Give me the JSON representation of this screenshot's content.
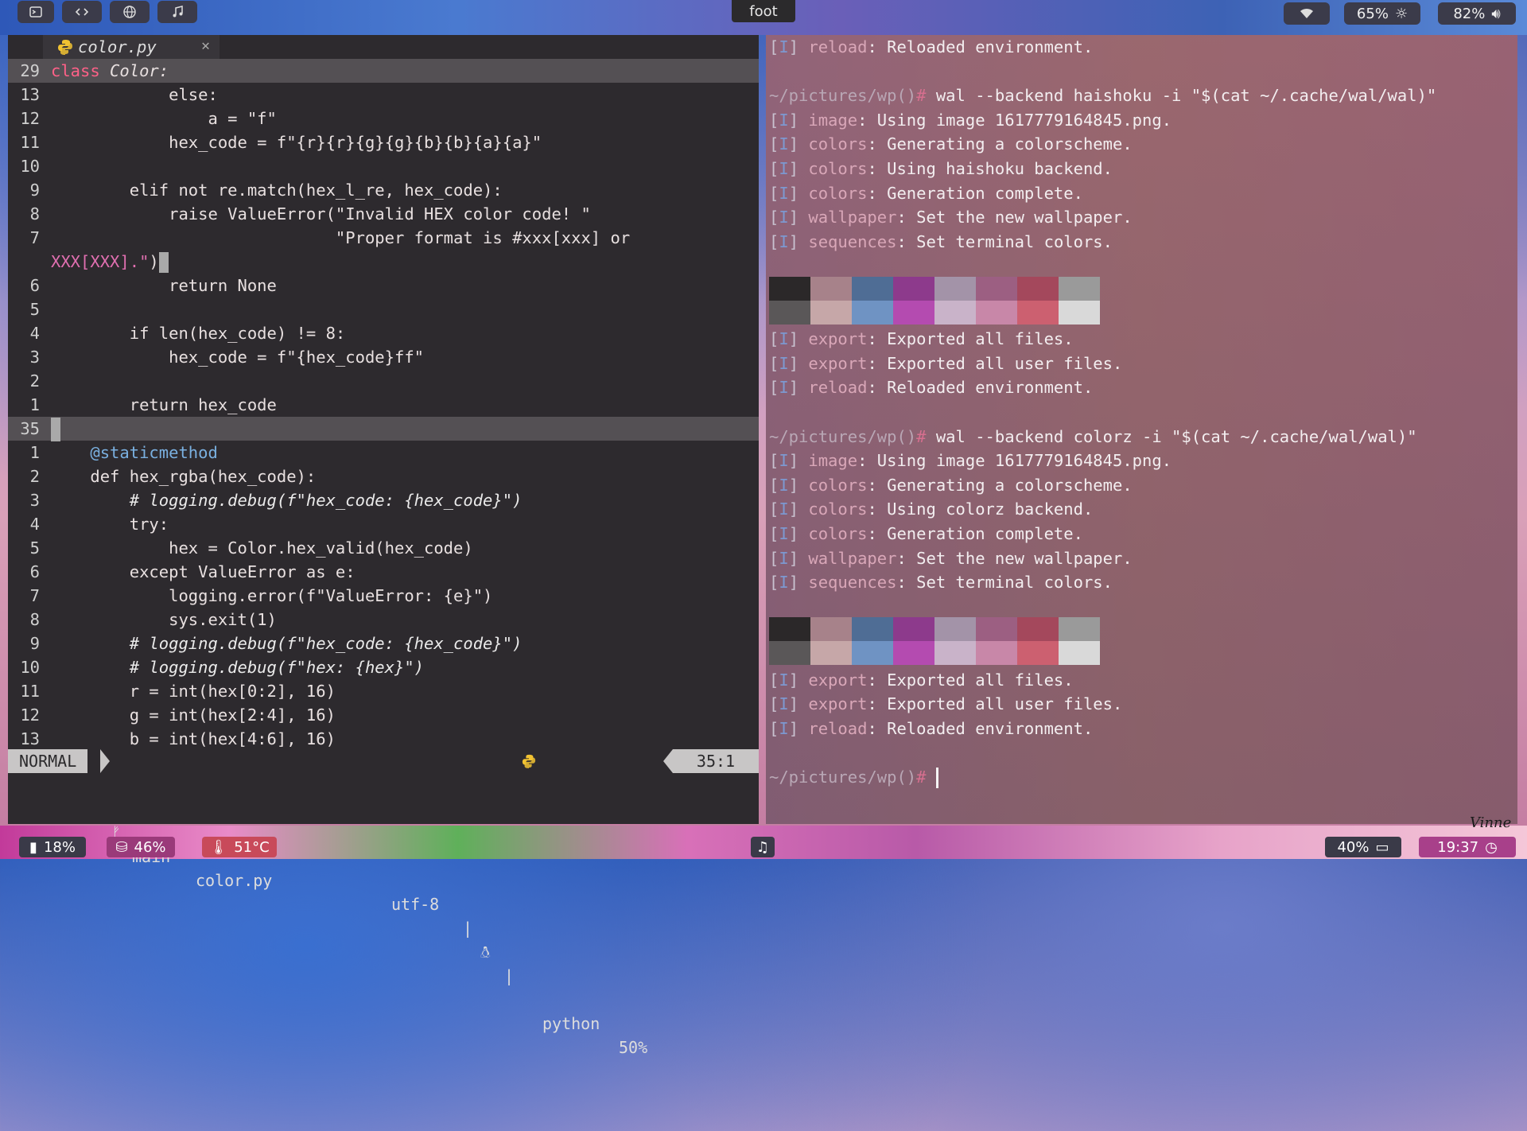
{
  "topbar": {
    "title": "foot",
    "wifi_icon": "wifi-icon",
    "brightness": "65%",
    "volume": "82%",
    "colors": {
      "pill_bg": "#3b3b4a"
    }
  },
  "editor": {
    "tab": {
      "filename": "color.py",
      "close": "✕"
    },
    "lines_upper": [
      {
        "n": "29",
        "kind": "class"
      },
      {
        "n": "13",
        "t": "            else:"
      },
      {
        "n": "12",
        "t": "                a = \"f\""
      },
      {
        "n": "11",
        "t": "            hex_code = f\"{r}{r}{g}{g}{b}{b}{a}{a}\""
      },
      {
        "n": "10",
        "t": ""
      },
      {
        "n": "9",
        "t": "        elif not re.match(hex_l_re, hex_code):"
      },
      {
        "n": "8",
        "t": "            raise ValueError(\"Invalid HEX color code! \""
      },
      {
        "n": "7",
        "t": "                             \"Proper format is #xxx[xxx] or"
      },
      {
        "n": "",
        "t": "XXX[XXX].\")"
      },
      {
        "n": "6",
        "t": "            return None"
      },
      {
        "n": "5",
        "t": ""
      },
      {
        "n": "4",
        "t": "        if len(hex_code) != 8:"
      },
      {
        "n": "3",
        "t": "            hex_code = f\"{hex_code}ff\""
      },
      {
        "n": "2",
        "t": ""
      },
      {
        "n": "1",
        "t": "        return hex_code"
      }
    ],
    "class_line": {
      "kw": "class",
      "name": " Color:"
    },
    "current_line": "35",
    "lines_lower": [
      {
        "n": "1",
        "t": "    @staticmethod"
      },
      {
        "n": "2",
        "t": "    def hex_rgba(hex_code):"
      },
      {
        "n": "3",
        "t": "        # logging.debug(f\"hex_code: {hex_code}\")"
      },
      {
        "n": "4",
        "t": "        try:"
      },
      {
        "n": "5",
        "t": "            hex = Color.hex_valid(hex_code)"
      },
      {
        "n": "6",
        "t": "        except ValueError as e:"
      },
      {
        "n": "7",
        "t": "            logging.error(f\"ValueError: {e}\")"
      },
      {
        "n": "8",
        "t": "            sys.exit(1)"
      },
      {
        "n": "9",
        "t": "        # logging.debug(f\"hex_code: {hex_code}\")"
      },
      {
        "n": "10",
        "t": "        # logging.debug(f\"hex: {hex}\")"
      },
      {
        "n": "11",
        "t": "        r = int(hex[0:2], 16)"
      },
      {
        "n": "12",
        "t": "        g = int(hex[2:4], 16)"
      },
      {
        "n": "13",
        "t": "        b = int(hex[4:6], 16)"
      }
    ],
    "status": {
      "mode": "NORMAL",
      "branch_icon": "git-branch-icon",
      "branch": "main",
      "file": "color.py",
      "encoding": "utf-8",
      "sep": "|",
      "os_icon": "linux-icon",
      "filetype": "python",
      "percent": "50%",
      "position": "35:1"
    }
  },
  "terminal": {
    "lines": [
      {
        "tag": "I",
        "mod": "reload",
        "msg": ": Reloaded environment."
      },
      {
        "blank": true
      },
      {
        "prompt": "~/pictures/wp()",
        "hash": "#",
        "cmd": " wal --backend haishoku -i \"$(cat ~/.cache/wal/wal)\""
      },
      {
        "tag": "I",
        "mod": "image",
        "msg": ": Using image 1617779164845.png."
      },
      {
        "tag": "I",
        "mod": "colors",
        "msg": ": Generating a colorscheme."
      },
      {
        "tag": "I",
        "mod": "colors",
        "msg": ": Using haishoku backend."
      },
      {
        "tag": "I",
        "mod": "colors",
        "msg": ": Generation complete."
      },
      {
        "tag": "I",
        "mod": "wallpaper",
        "msg": ": Set the new wallpaper."
      },
      {
        "tag": "I",
        "mod": "sequences",
        "msg": ": Set terminal colors."
      },
      {
        "blank": true
      },
      {
        "swatches": true
      },
      {
        "blank": true
      },
      {
        "tag": "I",
        "mod": "export",
        "msg": ": Exported all files."
      },
      {
        "tag": "I",
        "mod": "export",
        "msg": ": Exported all user files."
      },
      {
        "tag": "I",
        "mod": "reload",
        "msg": ": Reloaded environment."
      },
      {
        "blank": true
      },
      {
        "prompt": "~/pictures/wp()",
        "hash": "#",
        "cmd": " wal --backend colorz -i \"$(cat ~/.cache/wal/wal)\""
      },
      {
        "tag": "I",
        "mod": "image",
        "msg": ": Using image 1617779164845.png."
      },
      {
        "tag": "I",
        "mod": "colors",
        "msg": ": Generating a colorscheme."
      },
      {
        "tag": "I",
        "mod": "colors",
        "msg": ": Using colorz backend."
      },
      {
        "tag": "I",
        "mod": "colors",
        "msg": ": Generation complete."
      },
      {
        "tag": "I",
        "mod": "wallpaper",
        "msg": ": Set the new wallpaper."
      },
      {
        "tag": "I",
        "mod": "sequences",
        "msg": ": Set terminal colors."
      },
      {
        "blank": true
      },
      {
        "swatches": true
      },
      {
        "blank": true
      },
      {
        "tag": "I",
        "mod": "export",
        "msg": ": Exported all files."
      },
      {
        "tag": "I",
        "mod": "export",
        "msg": ": Exported all user files."
      },
      {
        "tag": "I",
        "mod": "reload",
        "msg": ": Reloaded environment."
      },
      {
        "blank": true
      },
      {
        "prompt": "~/pictures/wp()",
        "hash": "#",
        "cmd": " ",
        "cursor": true
      }
    ],
    "swatch_colors_top": [
      "#2b2829",
      "#a7828a",
      "#4f6d95",
      "#8d3a8c",
      "#a393a8",
      "#9c5f82",
      "#a4485c",
      "#9a9a9a"
    ],
    "swatch_colors_bottom": [
      "#5a5758",
      "#c6a7a8",
      "#6f93c3",
      "#b44bb0",
      "#c9b3c9",
      "#c887a8",
      "#cc6070",
      "#d9d9d9"
    ]
  },
  "bottombar": {
    "cpu": "18%",
    "disk": "46%",
    "temp": "51°C",
    "battery": "40%",
    "clock": "19:37",
    "colors": {
      "cpu_bg": "#3a3a48",
      "disk_bg": "#9a3a7a",
      "temp_bg": "#c84a5a",
      "clock_bg": "#a8408a"
    }
  },
  "wallpaper_signature": "Vinne"
}
